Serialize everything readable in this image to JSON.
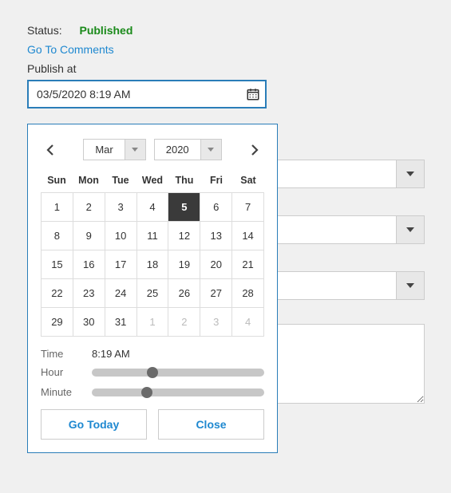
{
  "status": {
    "label": "Status:",
    "value": "Published"
  },
  "comments_link": "Go To Comments",
  "publish_at": {
    "label": "Publish at",
    "value": "03/5/2020 8:19 AM"
  },
  "picker": {
    "month": "Mar",
    "year": "2020",
    "dow": [
      "Sun",
      "Mon",
      "Tue",
      "Wed",
      "Thu",
      "Fri",
      "Sat"
    ],
    "days": [
      {
        "n": "1",
        "other": false,
        "sel": false
      },
      {
        "n": "2",
        "other": false,
        "sel": false
      },
      {
        "n": "3",
        "other": false,
        "sel": false
      },
      {
        "n": "4",
        "other": false,
        "sel": false
      },
      {
        "n": "5",
        "other": false,
        "sel": true
      },
      {
        "n": "6",
        "other": false,
        "sel": false
      },
      {
        "n": "7",
        "other": false,
        "sel": false
      },
      {
        "n": "8",
        "other": false,
        "sel": false
      },
      {
        "n": "9",
        "other": false,
        "sel": false
      },
      {
        "n": "10",
        "other": false,
        "sel": false
      },
      {
        "n": "11",
        "other": false,
        "sel": false
      },
      {
        "n": "12",
        "other": false,
        "sel": false
      },
      {
        "n": "13",
        "other": false,
        "sel": false
      },
      {
        "n": "14",
        "other": false,
        "sel": false
      },
      {
        "n": "15",
        "other": false,
        "sel": false
      },
      {
        "n": "16",
        "other": false,
        "sel": false
      },
      {
        "n": "17",
        "other": false,
        "sel": false
      },
      {
        "n": "18",
        "other": false,
        "sel": false
      },
      {
        "n": "19",
        "other": false,
        "sel": false
      },
      {
        "n": "20",
        "other": false,
        "sel": false
      },
      {
        "n": "21",
        "other": false,
        "sel": false
      },
      {
        "n": "22",
        "other": false,
        "sel": false
      },
      {
        "n": "23",
        "other": false,
        "sel": false
      },
      {
        "n": "24",
        "other": false,
        "sel": false
      },
      {
        "n": "25",
        "other": false,
        "sel": false
      },
      {
        "n": "26",
        "other": false,
        "sel": false
      },
      {
        "n": "27",
        "other": false,
        "sel": false
      },
      {
        "n": "28",
        "other": false,
        "sel": false
      },
      {
        "n": "29",
        "other": false,
        "sel": false
      },
      {
        "n": "30",
        "other": false,
        "sel": false
      },
      {
        "n": "31",
        "other": false,
        "sel": false
      },
      {
        "n": "1",
        "other": true,
        "sel": false
      },
      {
        "n": "2",
        "other": true,
        "sel": false
      },
      {
        "n": "3",
        "other": true,
        "sel": false
      },
      {
        "n": "4",
        "other": true,
        "sel": false
      }
    ],
    "time_label": "Time",
    "time_value": "8:19 AM",
    "hour_label": "Hour",
    "minute_label": "Minute",
    "hour_pct": 35,
    "minute_pct": 32,
    "today_btn": "Go Today",
    "close_btn": "Close"
  }
}
